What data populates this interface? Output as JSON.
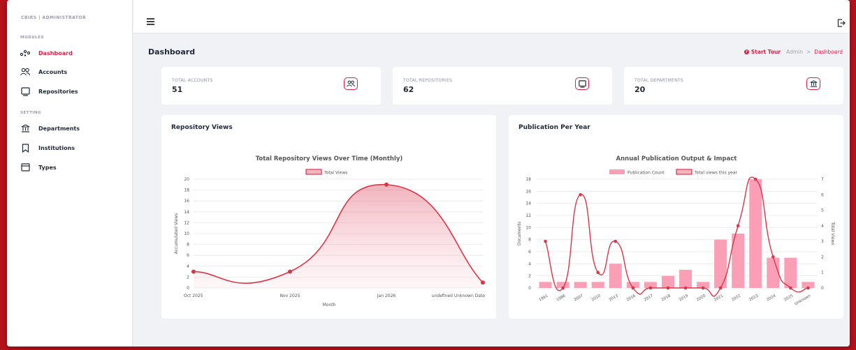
{
  "app": {
    "brand": "CBIRS | ADMINISTRATOR"
  },
  "sidebar": {
    "modules_title": "MODULES",
    "setting_title": "SETTING",
    "modules": [
      {
        "label": "Dashboard",
        "icon": "dashboard-icon",
        "active": true
      },
      {
        "label": "Accounts",
        "icon": "users-icon"
      },
      {
        "label": "Repositories",
        "icon": "repository-icon"
      }
    ],
    "settings": [
      {
        "label": "Departments",
        "icon": "bank-icon"
      },
      {
        "label": "Institutions",
        "icon": "bookmark-icon"
      },
      {
        "label": "Types",
        "icon": "window-icon"
      }
    ]
  },
  "header": {
    "page_title": "Dashboard",
    "start_tour": "Start Tour",
    "breadcrumb_root": "Admin",
    "breadcrumb_sep": ">",
    "breadcrumb_current": "Dashboard"
  },
  "stats": [
    {
      "label": "TOTAL ACCOUNTS",
      "value": "51",
      "icon": "users-icon"
    },
    {
      "label": "TOTAL REPOSITORIES",
      "value": "62",
      "icon": "repository-icon"
    },
    {
      "label": "TOTAL DEPARTMENTS",
      "value": "20",
      "icon": "bank-icon"
    }
  ],
  "panels": {
    "repo_views": "Repository Views",
    "publications": "Publication Per Year"
  },
  "colors": {
    "accent": "#e11d48",
    "line": "#dc3545",
    "bar": "#fb9fb6"
  },
  "chart_data": [
    {
      "type": "line",
      "title": "Total Repository Views Over Time (Monthly)",
      "xlabel": "Month",
      "ylabel": "Accumulated Views",
      "ylim": [
        0,
        20
      ],
      "yticks": [
        0,
        2,
        4,
        6,
        8,
        10,
        12,
        14,
        16,
        18,
        20
      ],
      "x": [
        "Oct 2025",
        "Nov 2025",
        "Jan 2026",
        "undefined Unknown Date"
      ],
      "series": [
        {
          "name": "Total Views",
          "values": [
            3,
            3,
            19,
            1
          ]
        }
      ],
      "legend": "top",
      "fill": true,
      "grid": true
    },
    {
      "type": "bar",
      "title": "Annual Publication Output & Impact",
      "ylabel": "Documents",
      "y2label": "Total Views",
      "ylim": [
        0,
        18
      ],
      "y2lim": [
        0,
        7
      ],
      "yticks": [
        0,
        2,
        4,
        6,
        8,
        10,
        12,
        14,
        16,
        18
      ],
      "y2ticks": [
        0,
        1,
        2,
        3,
        4,
        5,
        6,
        7
      ],
      "categories": [
        "1961",
        "1986",
        "2007",
        "2010",
        "2013",
        "2016",
        "2017",
        "2018",
        "2019",
        "2020",
        "2021",
        "2022",
        "2023",
        "2024",
        "2025",
        "Unknown"
      ],
      "series": [
        {
          "name": "Publication Count",
          "type": "bar",
          "values": [
            1,
            1,
            1,
            1,
            4,
            1,
            1,
            2,
            3,
            1,
            8,
            9,
            18,
            5,
            5,
            1
          ]
        },
        {
          "name": "Total views this year",
          "type": "line",
          "axis": "right",
          "values": [
            3,
            0,
            6,
            1,
            3,
            0,
            0,
            0,
            0,
            0,
            0,
            4,
            7,
            2,
            0,
            0
          ]
        }
      ],
      "legend": "top",
      "grid": true
    }
  ]
}
